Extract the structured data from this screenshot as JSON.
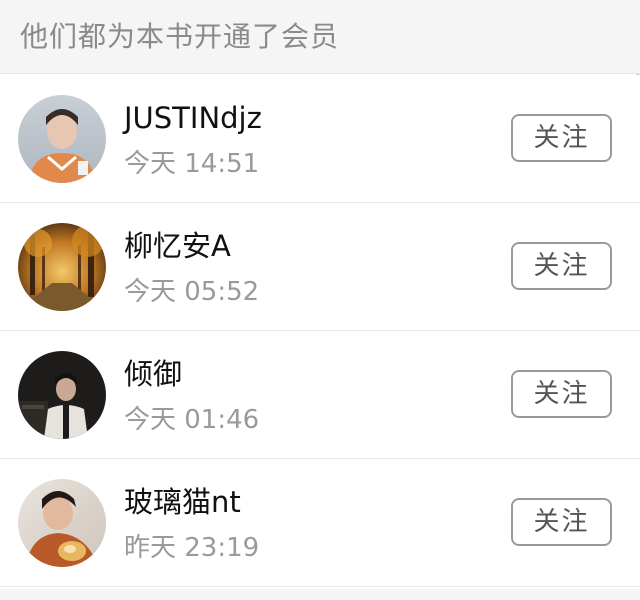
{
  "header": {
    "title": "他们都为本书开通了会员"
  },
  "members": [
    {
      "name": "JUSTINdjz",
      "time": "今天 14:51",
      "follow_label": "关注"
    },
    {
      "name": "柳忆安A",
      "time": "今天 05:52",
      "follow_label": "关注"
    },
    {
      "name": "倾御",
      "time": "今天 01:46",
      "follow_label": "关注"
    },
    {
      "name": "玻璃猫nt",
      "time": "昨天 23:19",
      "follow_label": "关注"
    }
  ]
}
